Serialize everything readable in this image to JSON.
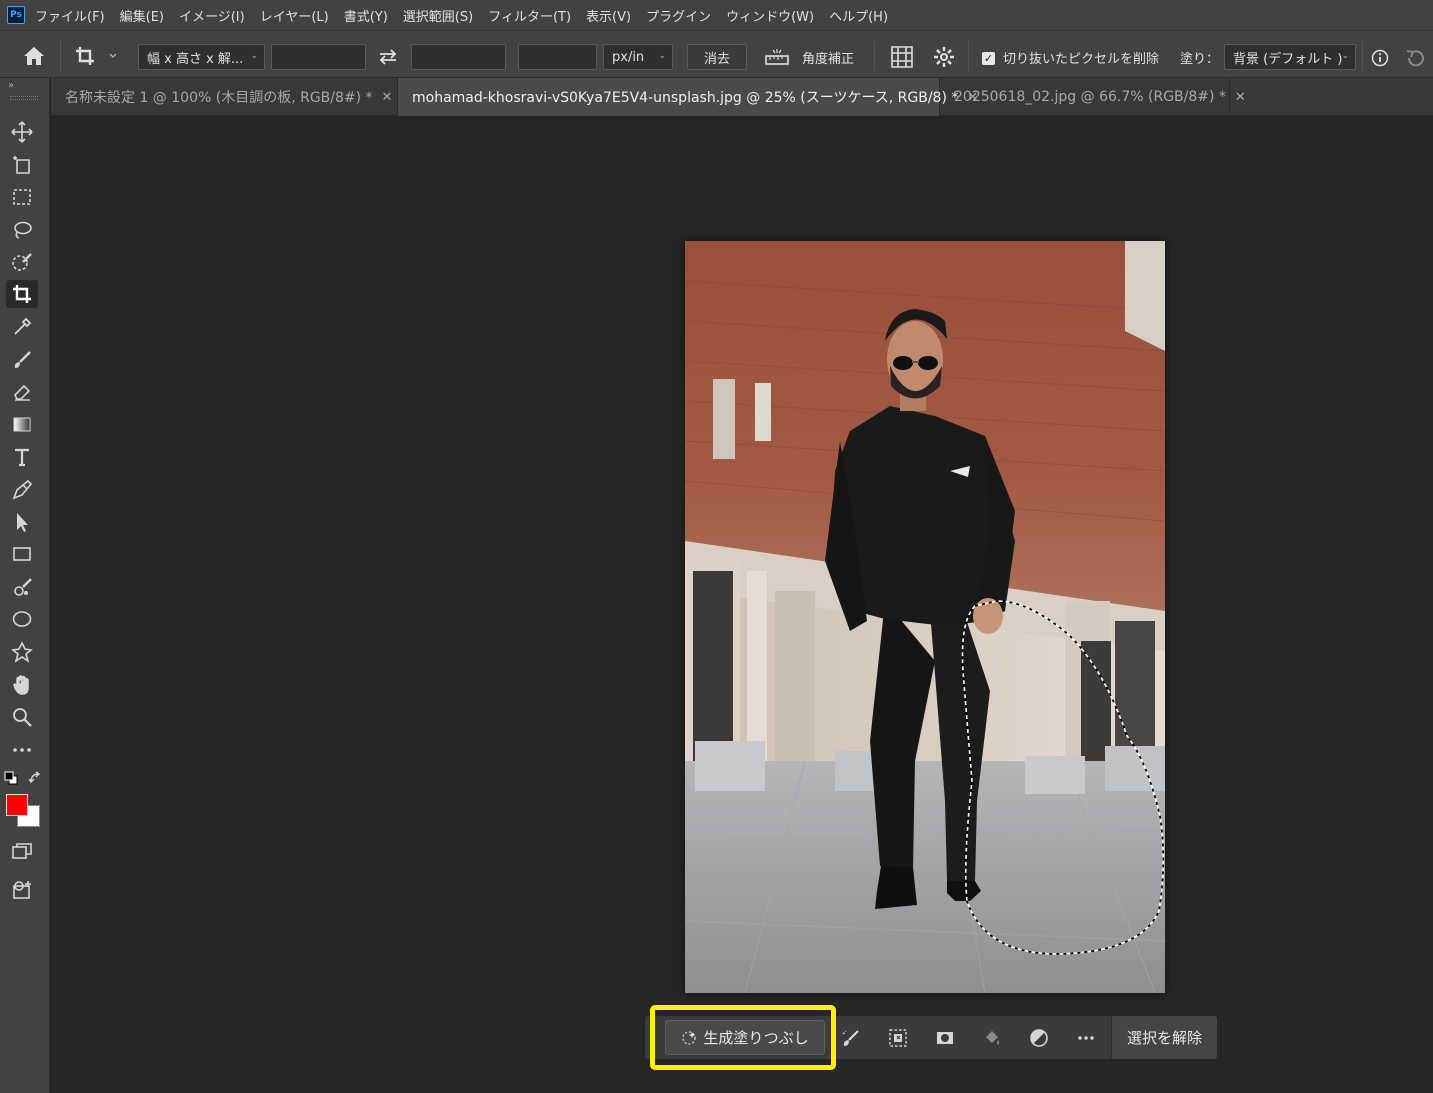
{
  "menubar": {
    "logo": "Ps",
    "items": [
      "ファイル(F)",
      "編集(E)",
      "イメージ(I)",
      "レイヤー(L)",
      "書式(Y)",
      "選択範囲(S)",
      "フィルター(T)",
      "表示(V)",
      "プラグイン",
      "ウィンドウ(W)",
      "ヘルプ(H)"
    ]
  },
  "options": {
    "ratio_select": "幅 x 高さ x 解...",
    "width_value": "",
    "height_value": "",
    "resolution_value": "",
    "unit_select": "px/in",
    "clear_button": "消去",
    "straighten_label": "角度補正",
    "delete_cropped_label": "切り抜いたピクセルを削除",
    "delete_cropped_checked": true,
    "fill_label": "塗り：",
    "fill_select": "背景 (デフォルト )"
  },
  "tabs": [
    {
      "label": "名称未設定 1 @ 100% (木目調の板, RGB/8#) *",
      "active": false
    },
    {
      "label": "mohamad-khosravi-vS0Kya7E5V4-unsplash.jpg @ 25% (スーツケース, RGB/8) *",
      "active": true
    },
    {
      "label": "20250618_02.jpg @ 66.7% (RGB/8#) *",
      "active": false
    }
  ],
  "colors": {
    "foreground": "#ff0000",
    "background": "#ffffff",
    "highlight": "#ffef00"
  },
  "taskbar": {
    "generative_fill_label": "生成塗りつぶし",
    "deselect_label": "選択を解除"
  }
}
